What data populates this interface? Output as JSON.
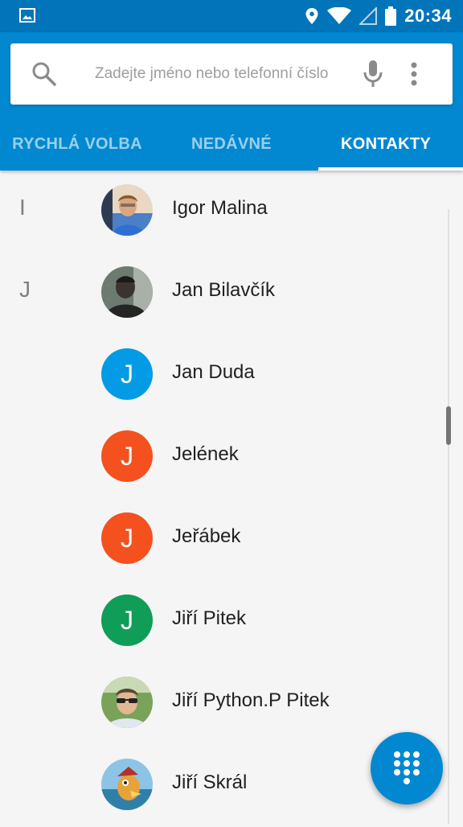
{
  "status_bar": {
    "time": "20:34"
  },
  "search": {
    "placeholder": "Zadejte jméno nebo telefonní číslo"
  },
  "tabs": [
    {
      "label": "RYCHLÁ VOLBA",
      "active": false
    },
    {
      "label": "NEDÁVNÉ",
      "active": false
    },
    {
      "label": "KONTAKTY",
      "active": true
    }
  ],
  "contacts": [
    {
      "section": "I",
      "name": "Igor Malina",
      "avatar": "photo"
    },
    {
      "section": "J",
      "name": "Jan Bilavčík",
      "avatar": "photo"
    },
    {
      "section": "",
      "name": "Jan Duda",
      "avatar": "letter",
      "initial": "J",
      "color": "#039be5"
    },
    {
      "section": "",
      "name": "Jelének",
      "avatar": "letter",
      "initial": "J",
      "color": "#f4511e"
    },
    {
      "section": "",
      "name": "Jeřábek",
      "avatar": "letter",
      "initial": "J",
      "color": "#f4511e"
    },
    {
      "section": "",
      "name": "Jiří Pitek",
      "avatar": "letter",
      "initial": "J",
      "color": "#0f9d58"
    },
    {
      "section": "",
      "name": "Jiří Python.P Pitek",
      "avatar": "photo"
    },
    {
      "section": "",
      "name": "Jiří Skrál",
      "avatar": "photo"
    }
  ],
  "colors": {
    "primary": "#0288d1",
    "status_bar": "#0275ba"
  }
}
